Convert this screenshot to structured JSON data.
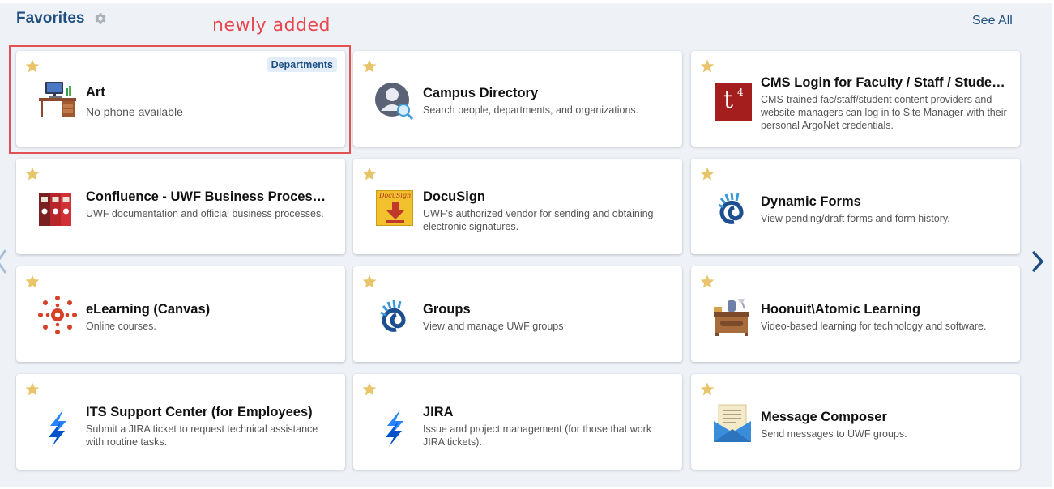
{
  "header": {
    "title": "Favorites",
    "annotation": "newly added",
    "see_all": "See All"
  },
  "cards": [
    {
      "title": "Art",
      "description": "No phone available",
      "badge": "Departments",
      "icon": "desk-computer-icon"
    },
    {
      "title": "Campus Directory",
      "description": "Search people, departments, and organizations.",
      "icon": "person-search-icon"
    },
    {
      "title": "CMS Login for Faculty / Staff / Stude…",
      "description": "CMS-trained fac/staff/student content providers and website managers can log in to Site Manager with their personal ArgoNet credentials.",
      "icon": "t4-logo-icon",
      "icon_text": "t",
      "icon_sup": "4"
    },
    {
      "title": "Confluence - UWF Business Proces…",
      "description": "UWF documentation and official business processes.",
      "icon": "binders-icon"
    },
    {
      "title": "DocuSign",
      "description": "UWF's authorized vendor for sending and obtaining electronic signatures.",
      "icon": "docusign-icon",
      "icon_text": "DocuSign"
    },
    {
      "title": "Dynamic Forms",
      "description": "View pending/draft forms and form history.",
      "icon": "nautilus-icon"
    },
    {
      "title": "eLearning (Canvas)",
      "description": "Online courses.",
      "icon": "canvas-icon"
    },
    {
      "title": "Groups",
      "description": "View and manage UWF groups",
      "icon": "nautilus-icon"
    },
    {
      "title": "Hoonuit\\Atomic Learning",
      "description": "Video-based learning for technology and software.",
      "icon": "desk-lamp-icon"
    },
    {
      "title": "ITS Support Center (for Employees)",
      "description": "Submit a JIRA ticket to request technical assistance with routine tasks.",
      "icon": "jira-icon"
    },
    {
      "title": "JIRA",
      "description": "Issue and project management (for those that work JIRA tickets).",
      "icon": "jira-icon"
    },
    {
      "title": "Message Composer",
      "description": "Send messages to UWF groups.",
      "icon": "envelope-letter-icon"
    }
  ],
  "colors": {
    "accent": "#1f4f82",
    "star": "#e8c56a",
    "annotation": "#e25252"
  }
}
